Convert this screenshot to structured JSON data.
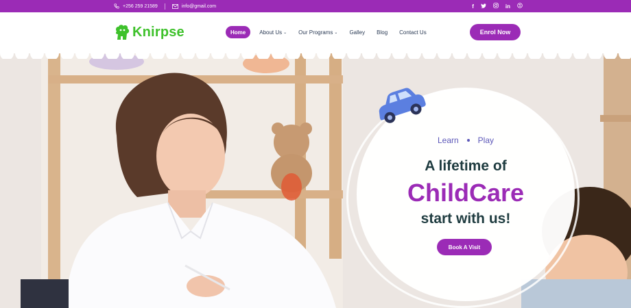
{
  "topbar": {
    "phone": "+256 259 21589",
    "email": "info@gmail.com",
    "social": [
      "facebook-icon",
      "twitter-icon",
      "instagram-icon",
      "linkedin-icon",
      "skype-icon"
    ]
  },
  "header": {
    "logo": {
      "prefix": "Knir",
      "suffix": "pse"
    },
    "nav": [
      {
        "label": "Home",
        "active": true
      },
      {
        "label": "About Us",
        "dropdown": true
      },
      {
        "label": "Our Programs",
        "dropdown": true
      },
      {
        "label": "Galley"
      },
      {
        "label": "Blog"
      },
      {
        "label": "Contact Us"
      }
    ],
    "cta": "Enrol Now"
  },
  "hero": {
    "tag_learn": "Learn",
    "tag_play": "Play",
    "line1": "A lifetime of",
    "line2": "ChildCare",
    "line3": "start with us!",
    "button": "Book A Visit"
  },
  "colors": {
    "brand": "#9b2bb6",
    "logo_green": "#3ec12b",
    "heading": "#1e3b3f",
    "tag": "#5b56b8"
  }
}
